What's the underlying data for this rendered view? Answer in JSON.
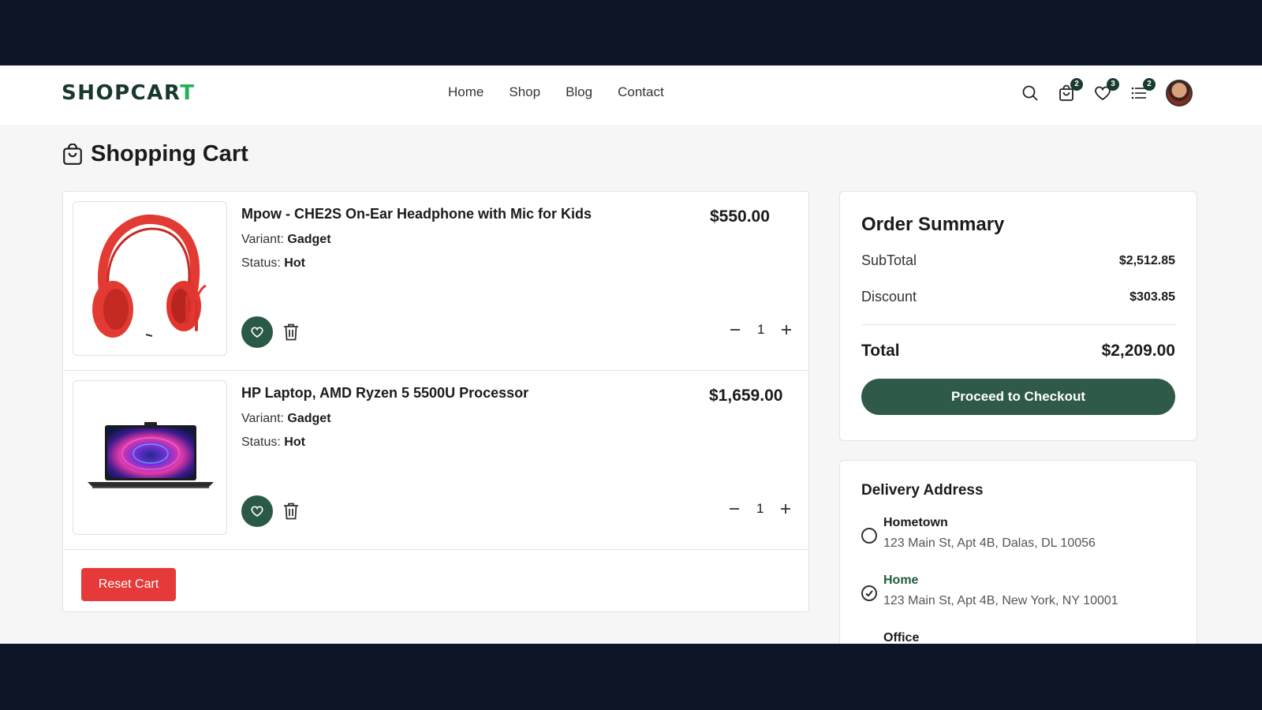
{
  "header": {
    "logo_main": "SHOPCAR",
    "logo_accent": "T",
    "nav": [
      "Home",
      "Shop",
      "Blog",
      "Contact"
    ],
    "icons": {
      "search": "search-icon",
      "cart": {
        "icon": "shopping-bag-icon",
        "badge": "2"
      },
      "wishlist": {
        "icon": "heart-icon",
        "badge": "3"
      },
      "compare": {
        "icon": "grid-icon",
        "badge": "2"
      }
    }
  },
  "page": {
    "title": "Shopping Cart"
  },
  "cart": {
    "items": [
      {
        "name": "Mpow - CHE2S On-Ear Headphone with Mic for Kids",
        "price": "$550.00",
        "variant_label": "Variant:",
        "variant": "Gadget",
        "status_label": "Status:",
        "status": "Hot",
        "quantity": "1"
      },
      {
        "name": "HP Laptop, AMD Ryzen 5 5500U Processor",
        "price": "$1,659.00",
        "variant_label": "Variant:",
        "variant": "Gadget",
        "status_label": "Status:",
        "status": "Hot",
        "quantity": "1"
      }
    ],
    "reset_label": "Reset Cart"
  },
  "summary": {
    "title": "Order Summary",
    "subtotal_label": "SubTotal",
    "subtotal": "$2,512.85",
    "discount_label": "Discount",
    "discount": "$303.85",
    "total_label": "Total",
    "total": "$2,209.00",
    "checkout_label": "Proceed to Checkout"
  },
  "delivery": {
    "title": "Delivery Address",
    "addresses": [
      {
        "name": "Hometown",
        "line": "123 Main St, Apt 4B, Dalas, DL 10056",
        "selected": false
      },
      {
        "name": "Home",
        "line": "123 Main St, Apt 4B, New York, NY 10001",
        "selected": true
      },
      {
        "name": "Office",
        "line": "",
        "selected": false
      }
    ]
  },
  "colors": {
    "brand_dark": "#17382a",
    "brand_accent": "#23b05a",
    "checkout": "#2f5a48",
    "reset": "#e63a3a"
  }
}
